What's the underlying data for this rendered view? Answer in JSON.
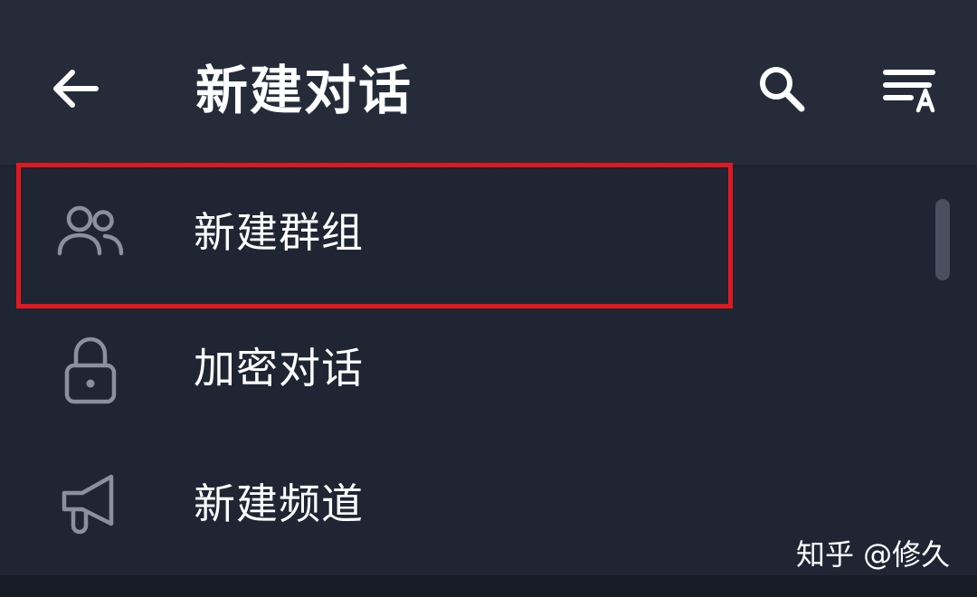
{
  "header": {
    "title": "新建对话",
    "back_icon": "arrow-left-icon",
    "search_icon": "search-icon",
    "sort_icon": "sort-alphabetical-icon"
  },
  "menu": {
    "items": [
      {
        "label": "新建群组",
        "icon": "group-icon"
      },
      {
        "label": "加密对话",
        "icon": "lock-icon"
      },
      {
        "label": "新建频道",
        "icon": "megaphone-icon"
      }
    ]
  },
  "highlight": {
    "color": "#e3171e"
  },
  "watermark": {
    "text": "知乎 @修久"
  },
  "colors": {
    "background": "#1f2533",
    "header": "#262b3a",
    "icon_gray": "#8a909c",
    "text": "#ffffff"
  }
}
